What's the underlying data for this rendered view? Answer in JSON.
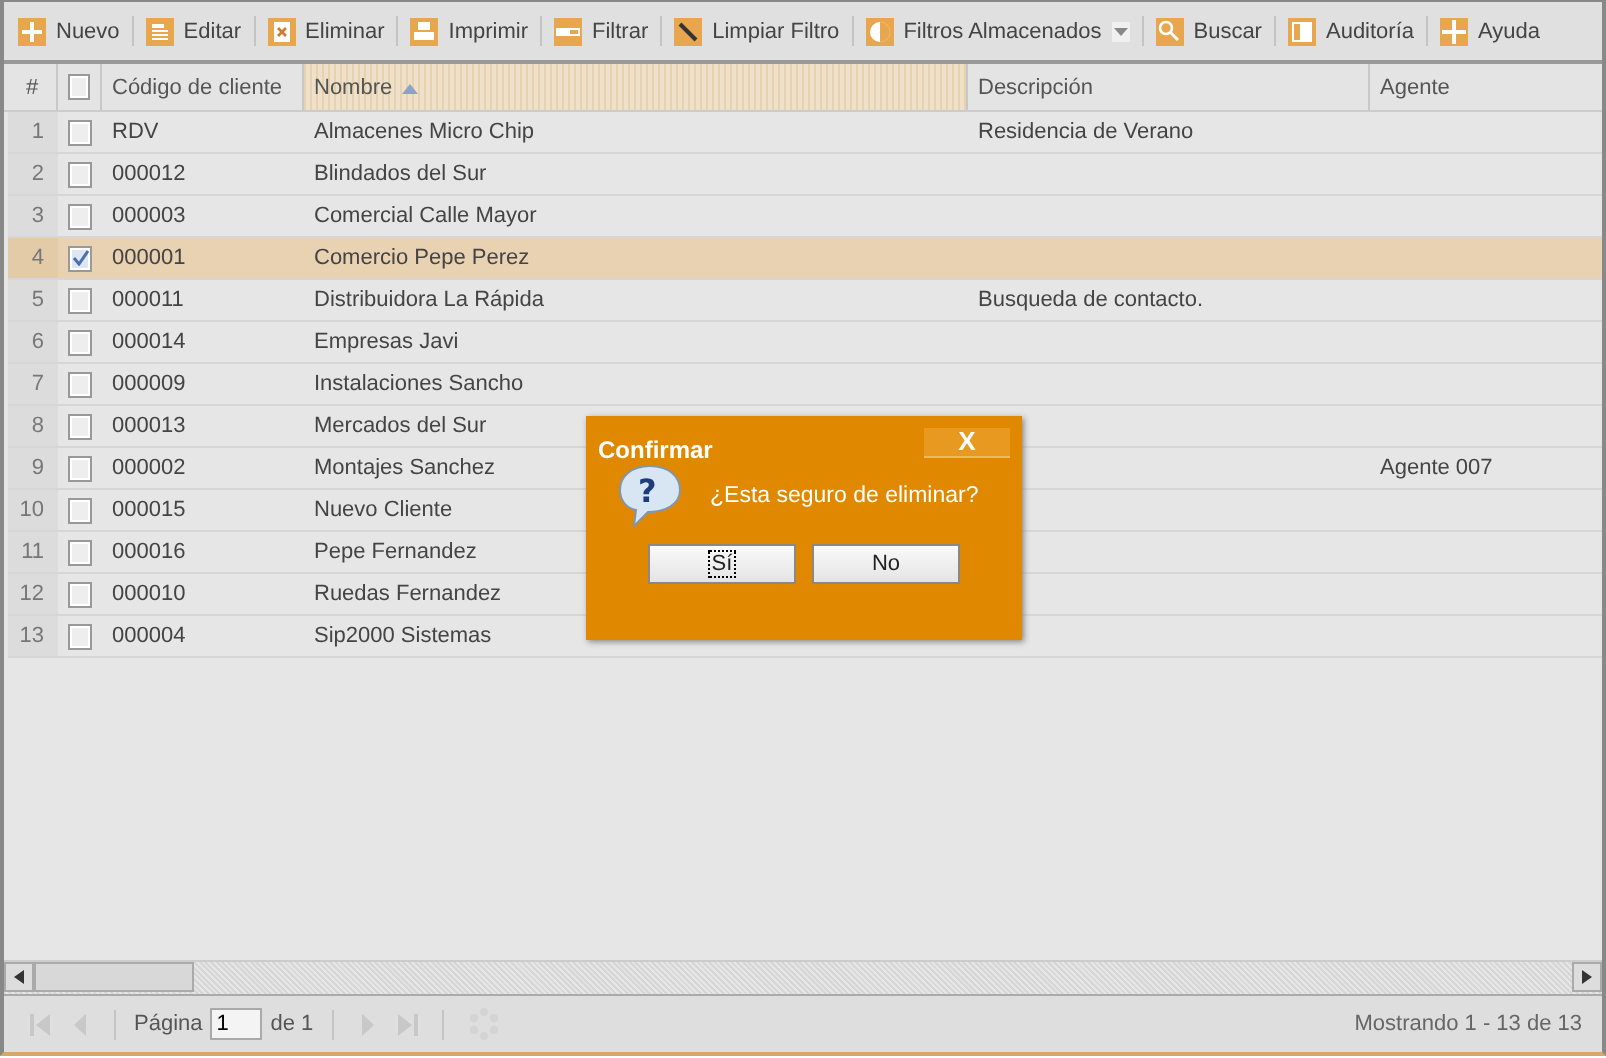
{
  "toolbar": [
    {
      "label": "Nuevo"
    },
    {
      "label": "Editar"
    },
    {
      "label": "Eliminar"
    },
    {
      "label": "Imprimir"
    },
    {
      "label": "Filtrar"
    },
    {
      "label": "Limpiar Filtro"
    },
    {
      "label": "Filtros Almacenados",
      "dropdown": true
    },
    {
      "label": "Buscar"
    },
    {
      "label": "Auditoría"
    },
    {
      "label": "Ayuda"
    }
  ],
  "table": {
    "columns": [
      {
        "label": "#",
        "kind": "number"
      },
      {
        "kind": "check",
        "checked": false
      },
      {
        "label": "Código de cliente",
        "kind": "text"
      },
      {
        "label": "Nombre",
        "kind": "text",
        "sorted": true
      },
      {
        "label": "Descripción",
        "kind": "text"
      },
      {
        "label": "Agente",
        "kind": "text"
      }
    ],
    "rows": [
      {
        "number": "1",
        "checked": false,
        "selected": false,
        "code": "RDV",
        "name": "Almacenes Micro Chip",
        "description": "Residencia de Verano",
        "agent": ""
      },
      {
        "number": "2",
        "checked": false,
        "selected": false,
        "code": "000012",
        "name": "Blindados del Sur",
        "description": "",
        "agent": ""
      },
      {
        "number": "3",
        "checked": false,
        "selected": false,
        "code": "000003",
        "name": "Comercial Calle Mayor",
        "description": "",
        "agent": ""
      },
      {
        "number": "4",
        "checked": true,
        "selected": true,
        "code": "000001",
        "name": "Comercio Pepe Perez",
        "description": "",
        "agent": ""
      },
      {
        "number": "5",
        "checked": false,
        "selected": false,
        "code": "000011",
        "name": "Distribuidora La Rápida",
        "description": "Busqueda de contacto.",
        "agent": ""
      },
      {
        "number": "6",
        "checked": false,
        "selected": false,
        "code": "000014",
        "name": "Empresas Javi",
        "description": "",
        "agent": ""
      },
      {
        "number": "7",
        "checked": false,
        "selected": false,
        "code": "000009",
        "name": "Instalaciones Sancho",
        "description": "",
        "agent": ""
      },
      {
        "number": "8",
        "checked": false,
        "selected": false,
        "code": "000013",
        "name": "Mercados del Sur",
        "description": "",
        "agent": ""
      },
      {
        "number": "9",
        "checked": false,
        "selected": false,
        "code": "000002",
        "name": "Montajes Sanchez",
        "description": "",
        "agent": "Agente 007"
      },
      {
        "number": "10",
        "checked": false,
        "selected": false,
        "code": "000015",
        "name": "Nuevo Cliente",
        "description": "",
        "agent": ""
      },
      {
        "number": "11",
        "checked": false,
        "selected": false,
        "code": "000016",
        "name": "Pepe Fernandez",
        "description": "",
        "agent": ""
      },
      {
        "number": "12",
        "checked": false,
        "selected": false,
        "code": "000010",
        "name": "Ruedas Fernandez",
        "description": "",
        "agent": ""
      },
      {
        "number": "13",
        "checked": false,
        "selected": false,
        "code": "000004",
        "name": "Sip2000 Sistemas",
        "description": "",
        "agent": ""
      }
    ]
  },
  "paging": {
    "page_label": "Página",
    "page": "1",
    "of_label": "de 1",
    "summary": "Mostrando 1 - 13 de 13"
  },
  "dialog": {
    "title": "Confirmar",
    "close": "X",
    "icon_text": "?",
    "message": "¿Esta seguro de eliminar?",
    "buttons": [
      {
        "label": "Sí",
        "focused": true
      },
      {
        "label": "No",
        "focused": false
      }
    ]
  }
}
